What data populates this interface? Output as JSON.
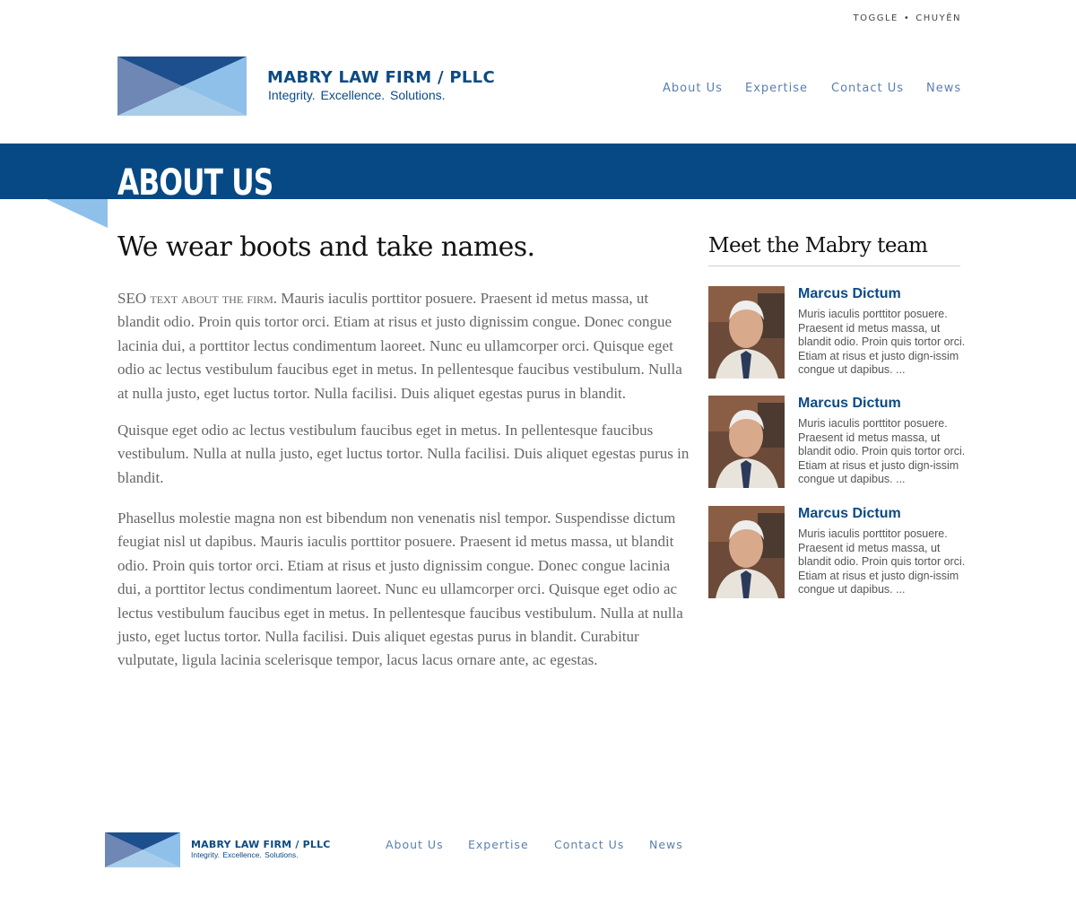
{
  "utility_links": {
    "toggle": "TOGGLE",
    "separator": "•",
    "chuyen": "CHUYÊN"
  },
  "brand": {
    "name": "MABRY LAW FIRM / PLLC",
    "tagline": "Integrity.  Excellence.  Solutions.",
    "colors": {
      "navy": "#064984",
      "light_blue": "#8fc0ea",
      "slate_blue": "#6f87b5",
      "dark_blue": "#1d4f8f"
    }
  },
  "nav": {
    "items": [
      "About Us",
      "Expertise",
      "Contact Us",
      "News"
    ]
  },
  "banner": {
    "title": "ABOUT US"
  },
  "main": {
    "headline": "We wear boots and take names.",
    "paragraphs": [
      {
        "lead": "SEO text about the firm.",
        "text": " Mauris iaculis porttitor posuere. Praesent id metus massa, ut blandit odio. Proin quis tortor orci. Etiam at risus et justo dignissim congue. Donec congue lacinia dui, a porttitor lectus condimentum laoreet. Nunc eu ullamcorper orci. Quisque eget odio ac lectus vestibulum faucibus eget in metus. In pellentesque faucibus vestibulum. Nulla at nulla justo, eget luctus tortor. Nulla facilisi. Duis aliquet egestas purus in blandit."
      },
      {
        "text": "Quisque eget odio ac lectus vestibulum faucibus eget in metus. In pellentesque faucibus vestibulum. Nulla at nulla justo, eget luctus tortor. Nulla facilisi. Duis aliquet egestas purus in blandit."
      },
      {
        "text": "Phasellus molestie magna non est bibendum non venenatis nisl tempor. Suspendisse dictum feugiat nisl ut dapibus. Mauris iaculis porttitor posuere. Praesent id metus massa, ut blandit odio. Proin quis tortor orci. Etiam at risus et justo dignissim congue. Donec congue lacinia dui, a porttitor lectus condimentum laoreet. Nunc eu ullamcorper orci. Quisque eget odio ac lectus vestibulum faucibus eget in metus. In pellentesque faucibus vestibulum. Nulla at nulla justo, eget luctus tortor. Nulla facilisi. Duis aliquet egestas purus in blandit. Curabitur vulputate, ligula lacinia scelerisque tempor, lacus lacus ornare ante, ac egestas."
      }
    ]
  },
  "sidebar": {
    "title": "Meet the Mabry team",
    "members": [
      {
        "name": "Marcus Dictum",
        "bio": "Muris iaculis porttitor posuere. Praesent id metus massa, ut blandit odio. Proin quis tortor orci. Etiam at risus et justo dign-issim congue ut dapibus. ..."
      },
      {
        "name": "Marcus Dictum",
        "bio": "Muris iaculis porttitor posuere. Praesent id metus massa, ut blandit odio. Proin quis tortor orci. Etiam at risus et justo dign-issim congue ut dapibus. ..."
      },
      {
        "name": "Marcus Dictum",
        "bio": "Muris iaculis porttitor posuere. Praesent id metus massa, ut blandit odio. Proin quis tortor orci. Etiam at risus et justo dign-issim congue ut dapibus. ..."
      }
    ]
  },
  "footer": {
    "brand_name": "MABRY LAW FIRM / PLLC",
    "tagline": "Integrity.  Excellence.  Solutions.",
    "nav": [
      "About Us",
      "Expertise",
      "Contact Us",
      "News"
    ]
  }
}
